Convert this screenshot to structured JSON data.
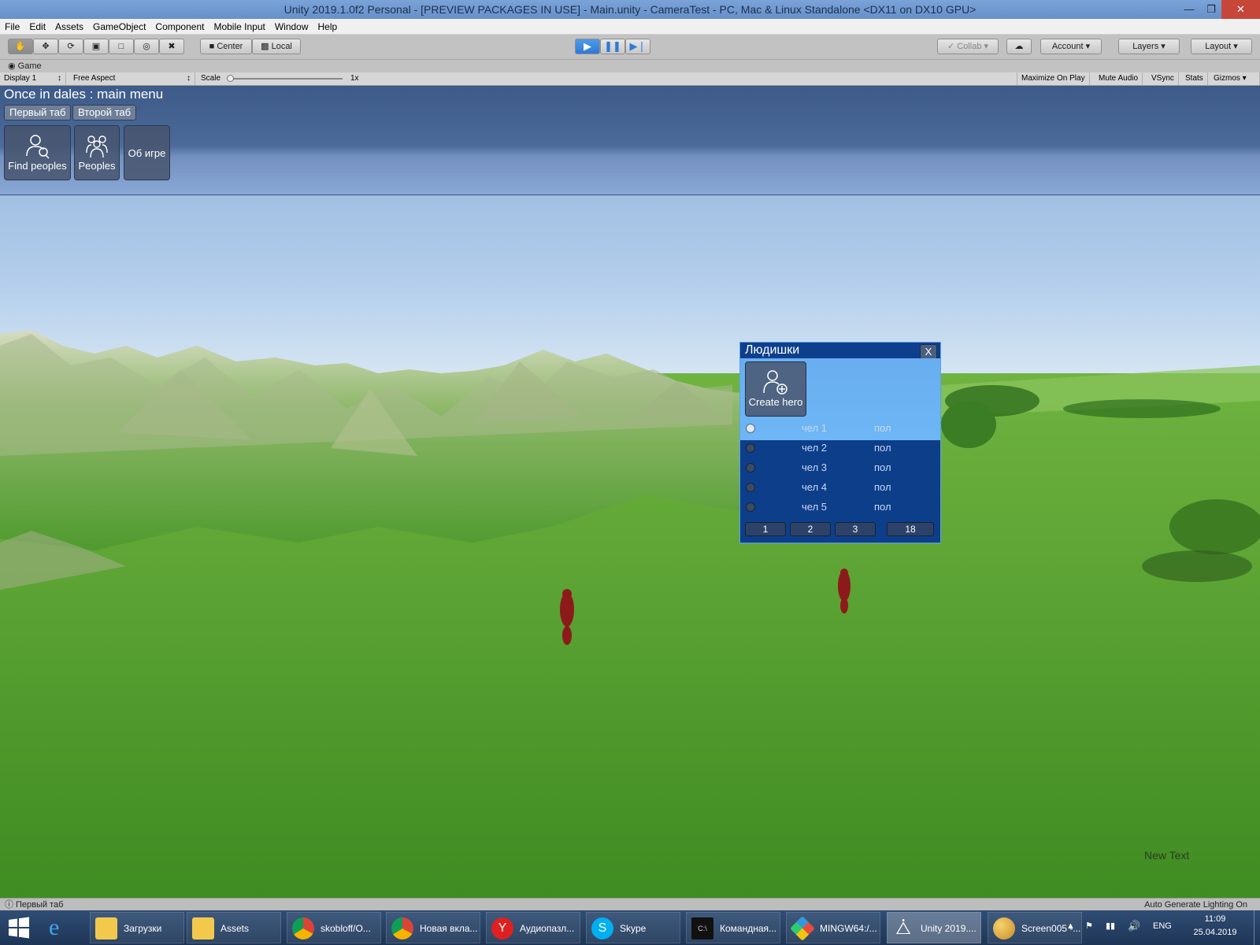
{
  "window": {
    "title": "Unity 2019.1.0f2 Personal - [PREVIEW PACKAGES IN USE] - Main.unity - CameraTest - PC, Mac & Linux Standalone <DX11 on DX10 GPU>"
  },
  "menu": [
    "File",
    "Edit",
    "Assets",
    "GameObject",
    "Component",
    "Mobile Input",
    "Window",
    "Help"
  ],
  "toolbar": {
    "center_label": "Center",
    "local_label": "Local",
    "collab_label": "Collab",
    "account_label": "Account",
    "layers_label": "Layers",
    "layout_label": "Layout"
  },
  "game_tab": {
    "label": "Game"
  },
  "gamebar": {
    "display": "Display 1",
    "aspect": "Free Aspect",
    "scale_label": "Scale",
    "scale_value": "1x",
    "maximize": "Maximize On Play",
    "mute": "Mute Audio",
    "vsync": "VSync",
    "stats": "Stats",
    "gizmos": "Gizmos"
  },
  "main_menu": {
    "title": "Once in dales : main menu",
    "tabs": [
      "Первый таб",
      "Второй таб"
    ],
    "buttons": [
      "Find peoples",
      "Peoples",
      "Об игре"
    ]
  },
  "people_window": {
    "title": "Людишки",
    "close": "X",
    "create_label": "Create hero",
    "rows": [
      {
        "name": "чел 1",
        "sex": "пол"
      },
      {
        "name": "чел 2",
        "sex": "пол"
      },
      {
        "name": "чел 3",
        "sex": "пол"
      },
      {
        "name": "чел 4",
        "sex": "пол"
      },
      {
        "name": "чел 5",
        "sex": "пол"
      }
    ],
    "pages": [
      "1",
      "2",
      "3",
      "18"
    ]
  },
  "new_text": "New Text",
  "status": {
    "left": "Первый таб",
    "right": "Auto Generate Lighting On"
  },
  "taskbar": {
    "items": [
      "Загрузки",
      "Assets",
      "skobloff/O...",
      "Новая вкла...",
      "Аудиопазл...",
      "Skype",
      "Командная...",
      "MINGW64:/...",
      "Unity 2019....",
      "Screen005 -..."
    ],
    "lang": "ENG",
    "time": "11:09",
    "date": "25.04.2019"
  }
}
